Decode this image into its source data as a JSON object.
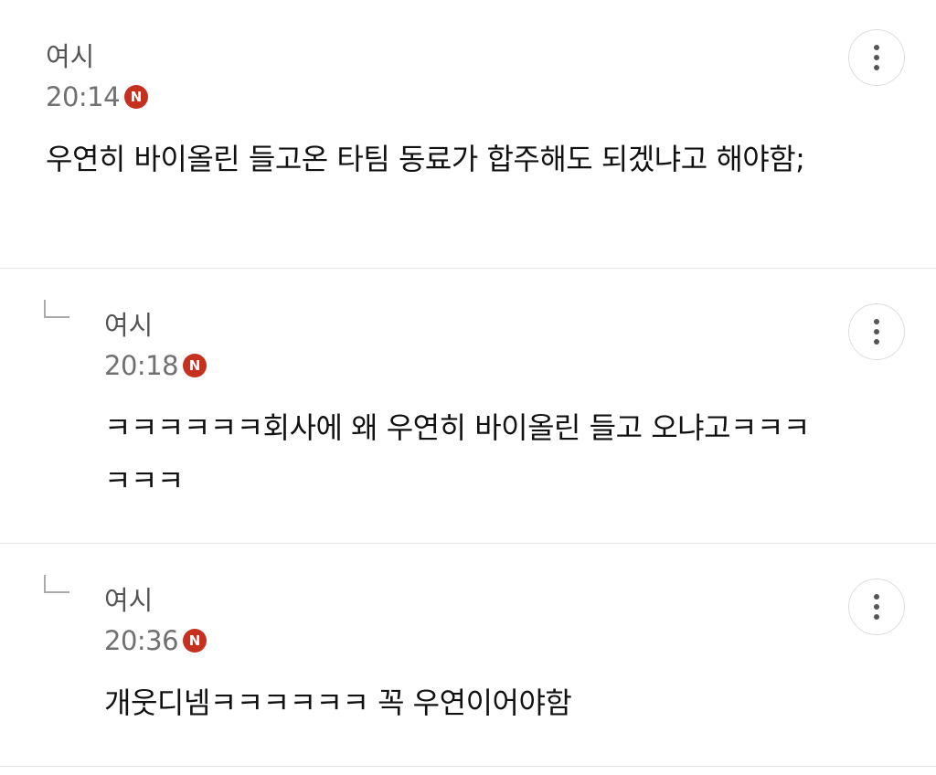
{
  "comments": [
    {
      "author": "여시",
      "time": "20:14",
      "badge": "N",
      "text": "우연히 바이올린 들고온 타팀 동료가 합주해도 되겠냐고 해야함;"
    },
    {
      "author": "여시",
      "time": "20:18",
      "badge": "N",
      "text": "ㅋㅋㅋㅋㅋㅋ회사에 왜 우연히 바이올린 들고 오냐고ㅋㅋㅋㅋㅋㅋ"
    },
    {
      "author": "여시",
      "time": "20:36",
      "badge": "N",
      "text": "개웃디넴ㅋㅋㅋㅋㅋㅋ 꼭 우연이어야함"
    }
  ],
  "colors": {
    "badge": "#c5301f",
    "divider": "#e3e3e3"
  },
  "icons": {
    "more": "more-vertical-icon",
    "reply": "reply-arrow-icon"
  }
}
